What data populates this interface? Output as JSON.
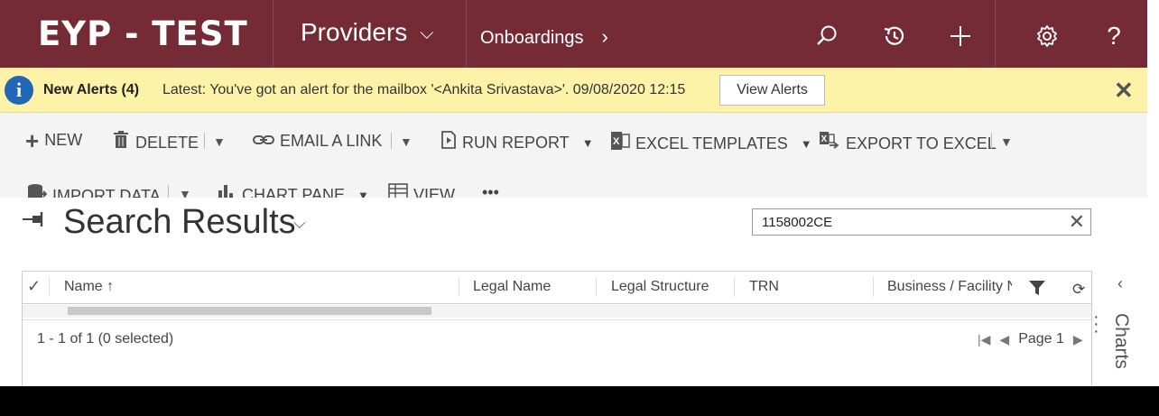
{
  "nav": {
    "app_title": "EYP - TEST",
    "area": "Providers",
    "entity": "Onboardings"
  },
  "alert": {
    "title": "New Alerts (4)",
    "message": "Latest: You've got an alert for the mailbox '<Ankita Srivastava>'. 09/08/2020 12:15",
    "button": "View Alerts"
  },
  "commands": {
    "new": "NEW",
    "delete": "DELETE",
    "email_link": "EMAIL A LINK",
    "run_report": "RUN REPORT",
    "excel_templates": "EXCEL TEMPLATES",
    "export_excel": "EXPORT TO EXCEL",
    "import_data": "IMPORT DATA",
    "chart_pane": "CHART PANE",
    "view": "VIEW",
    "more": "•••"
  },
  "page": {
    "title": "Search Results"
  },
  "search": {
    "value": "1158002CE"
  },
  "grid": {
    "columns": [
      "Name ↑",
      "Legal Name",
      "Legal Structure",
      "TRN",
      "Business / Facility N"
    ],
    "record_count": "1 - 1 of 1 (0 selected)",
    "page_label": "Page 1"
  },
  "side": {
    "charts_label": "Charts"
  }
}
